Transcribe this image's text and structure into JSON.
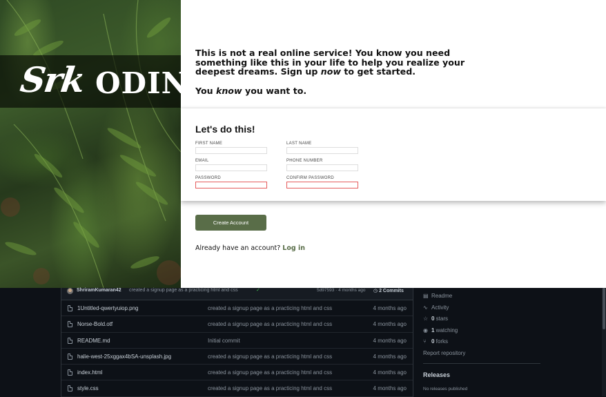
{
  "hero": {
    "logo_left": "Srk",
    "logo_right": "ODIN"
  },
  "intro": {
    "line1_a": "This is not a real online service! You know you need something like this in your life to help you realize your deepest dreams. Sign up ",
    "line1_em": "now",
    "line1_b": " to get started.",
    "line2_a": "You ",
    "line2_em": "know",
    "line2_b": " you want to."
  },
  "form": {
    "title": "Let's do this!",
    "first_name_label": "FIRST NAME",
    "last_name_label": "LAST NAME",
    "email_label": "EMAIL",
    "phone_label": "PHONE NUMBER",
    "password_label": "PASSWORD",
    "confirm_label": "CONFIRM PASSWORD",
    "first_name_value": "",
    "last_name_value": "",
    "email_value": "",
    "phone_value": "",
    "password_value": "",
    "confirm_value": ""
  },
  "actions": {
    "create_label": "Create Account",
    "login_prompt": "Already have an account? ",
    "login_link": "Log in"
  },
  "repo": {
    "commit": {
      "author": "ShriramKumaran42",
      "message": "created a signup page as a practicing html and css",
      "check": "✓",
      "sha": "5d97593 · 4 months ago",
      "count_icon": "history-icon",
      "count": "2 Commits"
    },
    "files": [
      {
        "name": "1Untitled-qwertyuiop.png",
        "message": "created a signup page as a practicing html and css",
        "age": "4 months ago"
      },
      {
        "name": "Norse-Bold.otf",
        "message": "created a signup page as a practicing html and css",
        "age": "4 months ago"
      },
      {
        "name": "README.md",
        "message": "Initial commit",
        "age": "4 months ago"
      },
      {
        "name": "halie-west-25xggax4bSA-unsplash.jpg",
        "message": "created a signup page as a practicing html and css",
        "age": "4 months ago"
      },
      {
        "name": "index.html",
        "message": "created a signup page as a practicing html and css",
        "age": "4 months ago"
      },
      {
        "name": "style.css",
        "message": "created a signup page as a practicing html and css",
        "age": "4 months ago"
      }
    ],
    "sidebar": {
      "readme": "Readme",
      "activity": "Activity",
      "stars_count": "0",
      "stars_label": " stars",
      "watching_count": "1",
      "watching_label": " watching",
      "forks_count": "0",
      "forks_label": " forks",
      "report": "Report repository",
      "releases_title": "Releases",
      "releases_empty": "No releases published"
    }
  },
  "colors": {
    "accent_green": "#596d48",
    "invalid_border": "#e55a5a",
    "dark_bg": "#0d1117"
  }
}
